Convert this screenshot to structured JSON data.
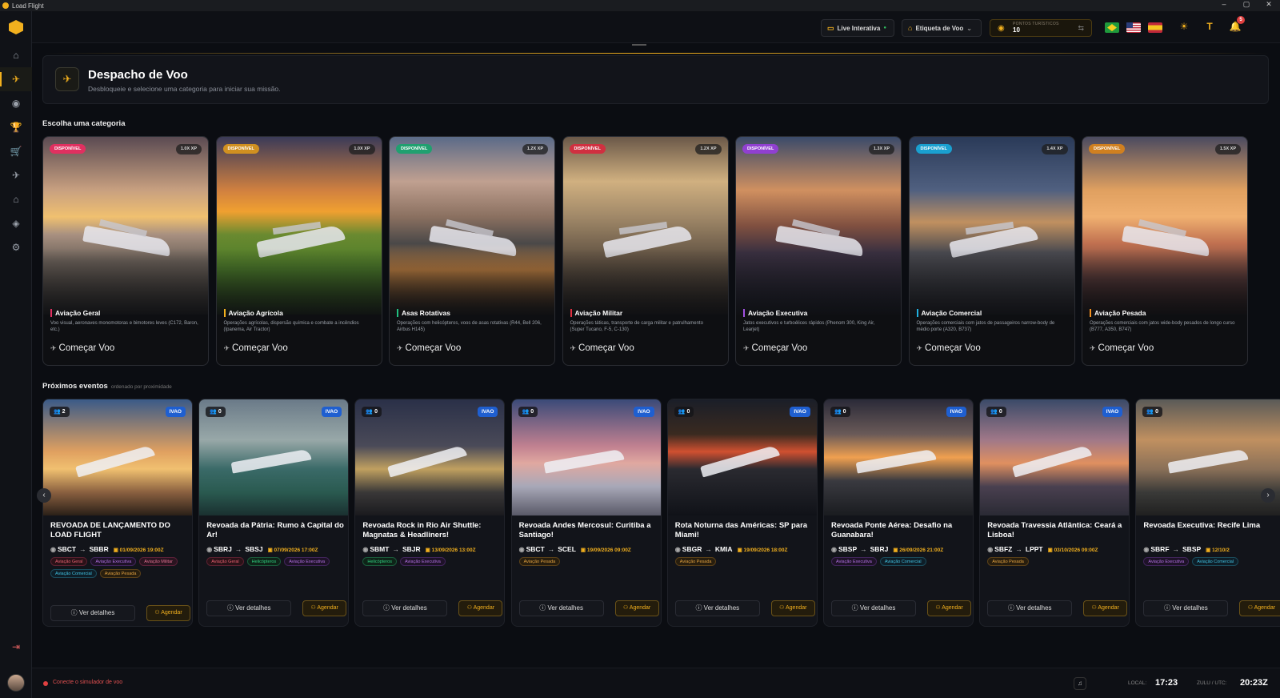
{
  "app": {
    "title": "Load Flight"
  },
  "window_controls": [
    "–",
    "▢",
    "✕"
  ],
  "sidebar": {
    "items": [
      {
        "name": "home-icon",
        "glyph": "⌂"
      },
      {
        "name": "flight-dispatch-icon",
        "glyph": "✈",
        "active": true
      },
      {
        "name": "radio-icon",
        "glyph": "◉"
      },
      {
        "name": "trophy-icon",
        "glyph": "🏆"
      },
      {
        "name": "cart-icon",
        "glyph": "🛒"
      },
      {
        "name": "plane-icon",
        "glyph": "✈"
      },
      {
        "name": "bank-icon",
        "glyph": "⌂"
      },
      {
        "name": "badge-icon",
        "glyph": "◈"
      },
      {
        "name": "settings-icon",
        "glyph": "⚙"
      }
    ]
  },
  "topbar": {
    "live_label": "Live Interativa",
    "tag_label": "Etiqueta de Voo",
    "points_label": "PONTOS TURÍSTICOS",
    "points_value": "10",
    "notifications_count": "5"
  },
  "header": {
    "title": "Despacho de Voo",
    "subtitle": "Desbloqueie e selecione uma categoria para iniciar sua missão."
  },
  "categories_title": "Escolha uma categoria",
  "categories": [
    {
      "badge": "DISPONÍVEL",
      "badge_color": "#e03060",
      "xp": "1.0X XP",
      "name": "Aviação Geral",
      "accent": "#e03060",
      "desc": "Voo visual, aeronaves monomotoras e bimotores leves (C172, Baron, etc.)",
      "cta": "Começar Voo"
    },
    {
      "badge": "DISPONÍVEL",
      "badge_color": "#d09020",
      "xp": "1.0X XP",
      "name": "Aviação Agrícola",
      "accent": "#f2b01e",
      "desc": "Operações agrícolas, dispersão química e combate a incêndios (Ipanema, Air Tractor)",
      "cta": "Começar Voo"
    },
    {
      "badge": "DISPONÍVEL",
      "badge_color": "#20a070",
      "xp": "1.2X XP",
      "name": "Asas Rotativas",
      "accent": "#20c080",
      "desc": "Operações com helicópteros, voos de asas rotativas (R44, Bell 206, Airbus H145)",
      "cta": "Começar Voo"
    },
    {
      "badge": "DISPONÍVEL",
      "badge_color": "#d03040",
      "xp": "1.2X XP",
      "name": "Aviação Militar",
      "accent": "#e03040",
      "desc": "Operações táticas, transporte de carga militar e patrulhamento (Super Tucano, F-5, C-130)",
      "cta": "Começar Voo"
    },
    {
      "badge": "DISPONÍVEL",
      "badge_color": "#9040d0",
      "xp": "1.3X XP",
      "name": "Aviação Executiva",
      "accent": "#a050e0",
      "desc": "Jatos executivos e turboélices rápidos (Phenom 300, King Air, Learjet)",
      "cta": "Começar Voo"
    },
    {
      "badge": "DISPONÍVEL",
      "badge_color": "#1aa0d0",
      "xp": "1.4X XP",
      "name": "Aviação Comercial",
      "accent": "#20b0e0",
      "desc": "Operações comerciais com jatos de passageiros narrow-body de médio porte (A320, B737)",
      "cta": "Começar Voo"
    },
    {
      "badge": "DISPONÍVEL",
      "badge_color": "#d08020",
      "xp": "1.5X XP",
      "name": "Aviação Pesada",
      "accent": "#f29020",
      "desc": "Operações comerciais com jatos wide-body pesados de longo curso (B777, A350, B747)",
      "cta": "Começar Voo"
    }
  ],
  "events_title": "Próximos eventos",
  "events_subtitle": "ordenado por proximidade",
  "events": [
    {
      "count": "2",
      "network": "IVAO",
      "title": "REVOADA DE LANÇAMENTO DO LOAD FLIGHT",
      "from": "SBCT",
      "to": "SBBR",
      "date": "01/09/2026 19:00Z",
      "tags": [
        {
          "t": "Aviação Geral",
          "c": "geral"
        },
        {
          "t": "Aviação Executiva",
          "c": "exec"
        },
        {
          "t": "Aviação Militar",
          "c": "mil"
        },
        {
          "t": "Aviação Comercial",
          "c": "com"
        },
        {
          "t": "Aviação Pesada",
          "c": "pes"
        }
      ],
      "details": "Ver detalhes",
      "schedule": "Agendar"
    },
    {
      "count": "0",
      "network": "IVAO",
      "title": "Revoada da Pátria: Rumo à Capital do Ar!",
      "from": "SBRJ",
      "to": "SBSJ",
      "date": "07/09/2026 17:00Z",
      "tags": [
        {
          "t": "Aviação Geral",
          "c": "geral"
        },
        {
          "t": "Helicópteros",
          "c": "heli"
        },
        {
          "t": "Aviação Executiva",
          "c": "exec"
        }
      ],
      "details": "Ver detalhes",
      "schedule": "Agendar"
    },
    {
      "count": "0",
      "network": "IVAO",
      "title": "Revoada Rock in Rio Air Shuttle: Magnatas & Headliners!",
      "from": "SBMT",
      "to": "SBJR",
      "date": "13/09/2026 13:00Z",
      "tags": [
        {
          "t": "Helicópteros",
          "c": "heli"
        },
        {
          "t": "Aviação Executiva",
          "c": "exec"
        }
      ],
      "details": "Ver detalhes",
      "schedule": "Agendar"
    },
    {
      "count": "0",
      "network": "IVAO",
      "title": "Revoada Andes Mercosul: Curitiba a Santiago!",
      "from": "SBCT",
      "to": "SCEL",
      "date": "19/09/2026 09:00Z",
      "tags": [
        {
          "t": "Aviação Pesada",
          "c": "pes"
        }
      ],
      "details": "Ver detalhes",
      "schedule": "Agendar"
    },
    {
      "count": "0",
      "network": "IVAO",
      "title": "Rota Noturna das Américas: SP para Miami!",
      "from": "SBGR",
      "to": "KMIA",
      "date": "19/09/2026 18:00Z",
      "tags": [
        {
          "t": "Aviação Pesada",
          "c": "pes"
        }
      ],
      "details": "Ver detalhes",
      "schedule": "Agendar"
    },
    {
      "count": "0",
      "network": "IVAO",
      "title": "Revoada Ponte Aérea: Desafio na Guanabara!",
      "from": "SBSP",
      "to": "SBRJ",
      "date": "26/09/2026 21:00Z",
      "tags": [
        {
          "t": "Aviação Executiva",
          "c": "exec"
        },
        {
          "t": "Aviação Comercial",
          "c": "com"
        }
      ],
      "details": "Ver detalhes",
      "schedule": "Agendar"
    },
    {
      "count": "0",
      "network": "IVAO",
      "title": "Revoada Travessia Atlântica: Ceará a Lisboa!",
      "from": "SBFZ",
      "to": "LPPT",
      "date": "03/10/2026 09:00Z",
      "tags": [
        {
          "t": "Aviação Pesada",
          "c": "pes"
        }
      ],
      "details": "Ver detalhes",
      "schedule": "Agendar"
    },
    {
      "count": "0",
      "network": "",
      "title": "Revoada Executiva: Recife Lima",
      "from": "SBRF",
      "to": "SBSP",
      "date": "12/10/2",
      "tags": [
        {
          "t": "Aviação Executiva",
          "c": "exec"
        },
        {
          "t": "Aviação Comercial",
          "c": "com"
        }
      ],
      "details": "Ver detalhes",
      "schedule": "Agendar"
    }
  ],
  "footer": {
    "status": "Conecte o simulador de voo",
    "local_label": "LOCAL:",
    "local_time": "17:23",
    "zulu_label": "ZULU / UTC:",
    "zulu_time": "20:23Z"
  }
}
